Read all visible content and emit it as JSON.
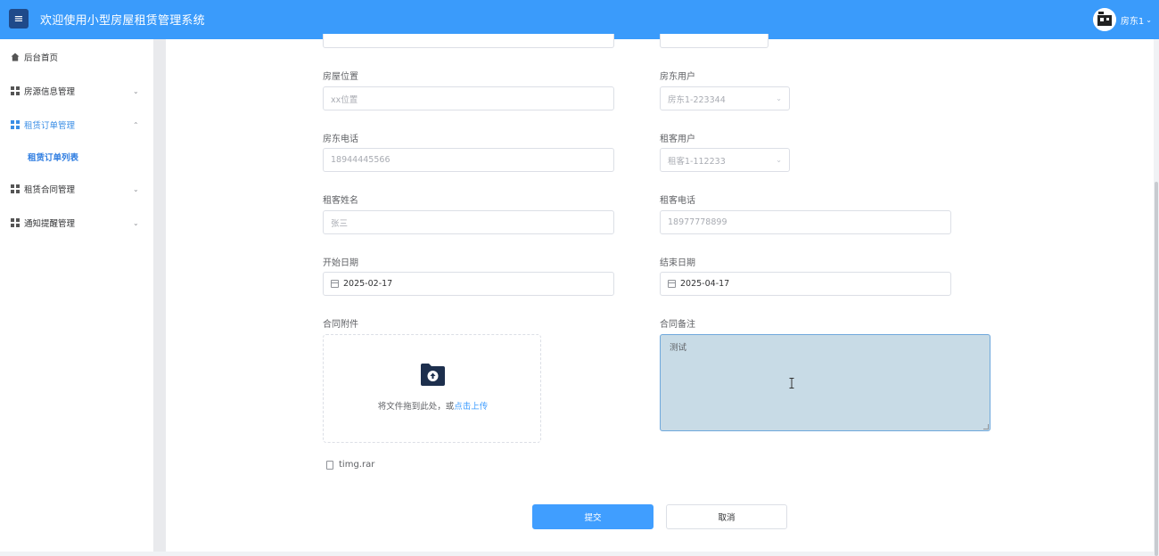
{
  "header": {
    "menu_icon": "hamburger-icon",
    "title": "欢迎使用小型房屋租赁管理系统",
    "user_name": "房东1",
    "accent_color": "#3a9bfb"
  },
  "sidebar": {
    "items": [
      {
        "label": "后台首页",
        "icon": "home-icon"
      },
      {
        "label": "房源信息管理",
        "icon": "grid-icon"
      },
      {
        "label": "租赁订单管理",
        "icon": "grid-icon",
        "expanded": true
      },
      {
        "label": "租赁订单列表",
        "icon": null,
        "sub": true,
        "active": true
      },
      {
        "label": "租赁合同管理",
        "icon": "grid-icon"
      },
      {
        "label": "通知提醒管理",
        "icon": "grid-icon"
      }
    ]
  },
  "form": {
    "house_location": {
      "label": "房屋位置",
      "value": "xx位置"
    },
    "landlord_user": {
      "label": "房东用户",
      "value": "房东1-223344"
    },
    "landlord_phone": {
      "label": "房东电话",
      "value": "18944445566"
    },
    "tenant_user": {
      "label": "租客用户",
      "value": "租客1-112233"
    },
    "tenant_name": {
      "label": "租客姓名",
      "value": "张三"
    },
    "tenant_phone": {
      "label": "租客电话",
      "value": "18977778899"
    },
    "start_date": {
      "label": "开始日期",
      "value": "2025-02-17"
    },
    "end_date": {
      "label": "结束日期",
      "value": "2025-04-17"
    },
    "attachment": {
      "label": "合同附件",
      "drag_text": "将文件拖到此处，或",
      "click_text": "点击上传",
      "file_name": "timg.rar"
    },
    "remark": {
      "label": "合同备注",
      "value": "测试"
    }
  },
  "actions": {
    "submit": "提交",
    "cancel": "取消"
  }
}
